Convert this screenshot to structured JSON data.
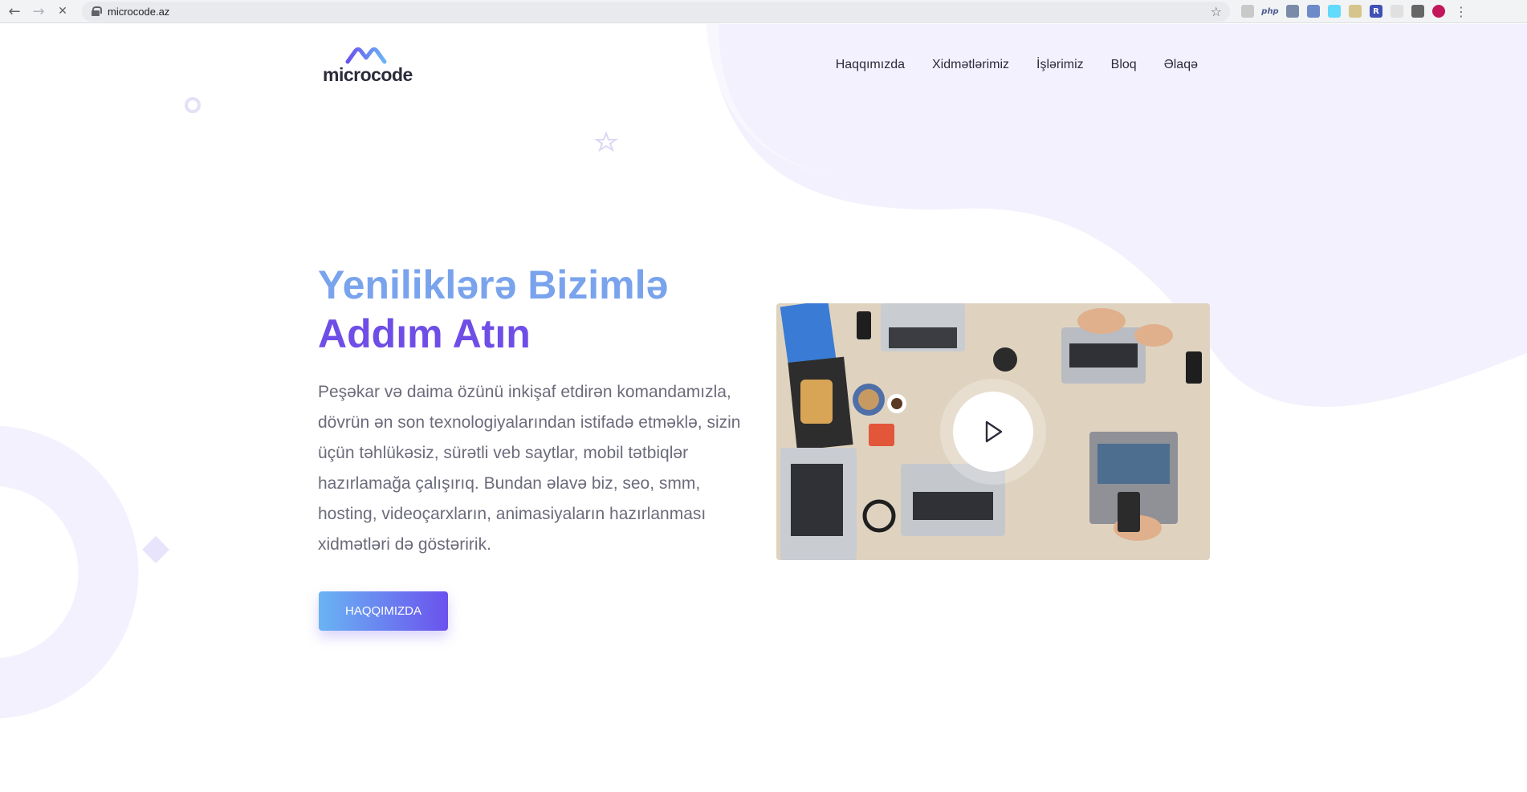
{
  "browser": {
    "url": "microcode.az",
    "back_icon": "←",
    "forward_icon": "→",
    "reload_icon": "✕",
    "star_icon": "☆",
    "menu_icon": "⋮",
    "extensions": [
      {
        "name": "face-extension",
        "label": "",
        "color": "#c9c9c9"
      },
      {
        "name": "php-extension",
        "label": "php",
        "color": "#4f5b93"
      },
      {
        "name": "camera-extension",
        "label": "",
        "color": "#7a8aa8"
      },
      {
        "name": "compass-extension",
        "label": "",
        "color": "#6d8bc9"
      },
      {
        "name": "react-extension",
        "label": "",
        "color": "#61dafb"
      },
      {
        "name": "tag-extension",
        "label": "",
        "color": "#d6c58a"
      },
      {
        "name": "r-extension",
        "label": "R",
        "color": "#3f51b5"
      },
      {
        "name": "blank-extension",
        "label": "",
        "color": "#e0e0e0"
      },
      {
        "name": "screenshot-extension",
        "label": "",
        "color": "#666666"
      },
      {
        "name": "profile-avatar",
        "label": "",
        "color": "#c2185b"
      }
    ]
  },
  "site": {
    "logo_text": "microcode",
    "nav": [
      "Haqqımızda",
      "Xidmətlərimiz",
      "İşlərimiz",
      "Bloq",
      "Əlaqə"
    ]
  },
  "hero": {
    "title_line1": "Yeniliklərə Bizimlə",
    "title_line2": "Addım Atın",
    "description": "Peşəkar və daima özünü inkişaf etdirən komandamızla, dövrün ən son texnologiyalarından istifadə etməklə, sizin üçün təhlükəsiz, sürətli veb saytlar, mobil tətbiqlər hazırlamağa çalışırıq. Bundan əlavə biz, seo, smm, hosting, videoçarxların, animasiyaların hazırlanması xidmətləri də göstəririk.",
    "cta_label": "HAQQIMIZDA"
  },
  "colors": {
    "accent_light": "#79a3ec",
    "accent_dark": "#6e4ee6",
    "blob": "#f3f1fd"
  }
}
